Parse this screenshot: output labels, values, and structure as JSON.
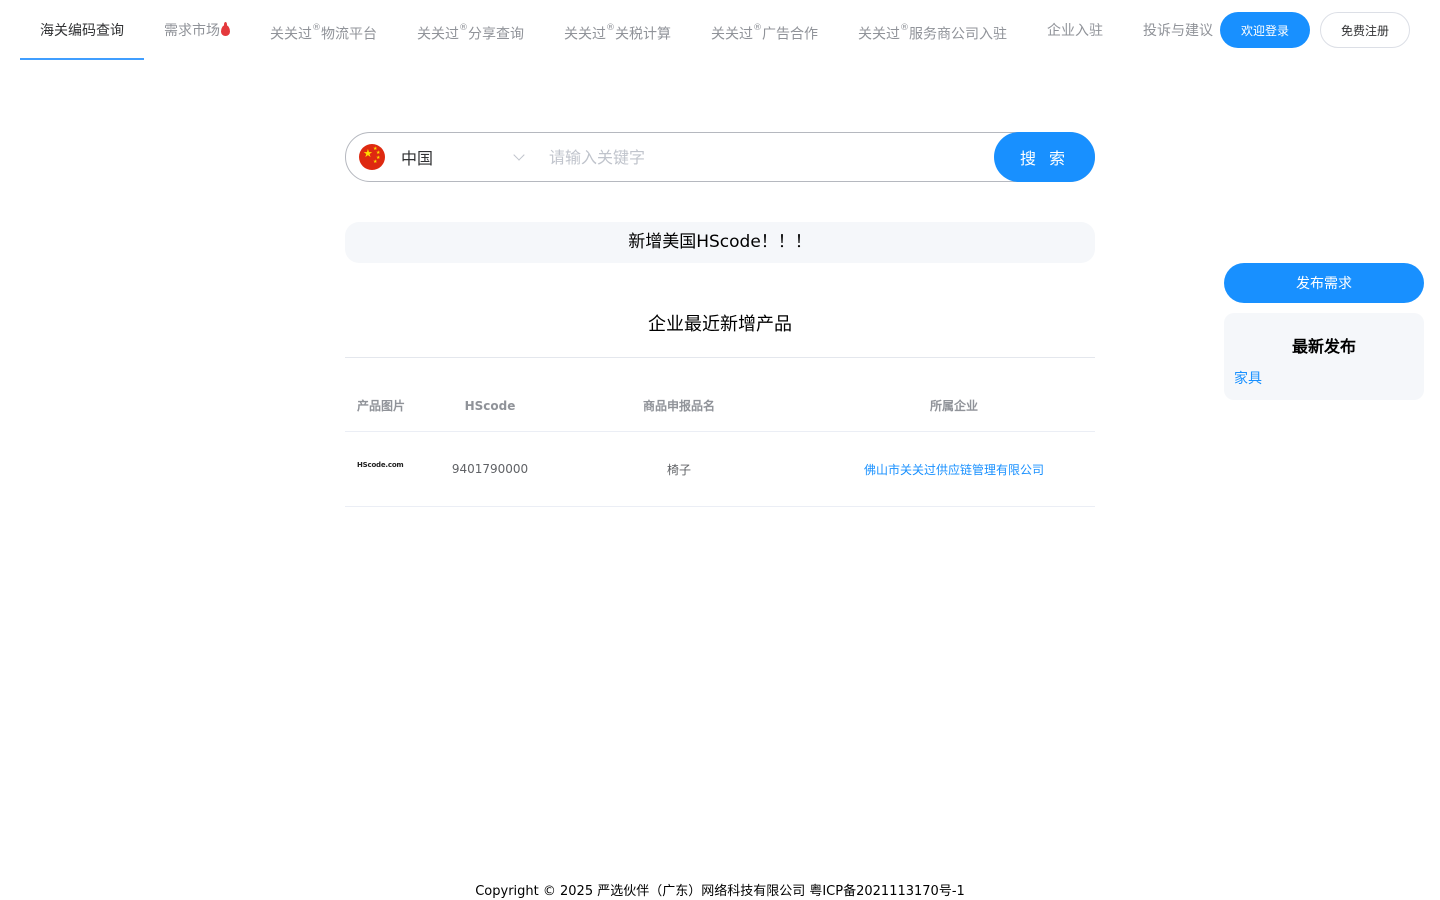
{
  "nav": {
    "items": [
      {
        "label": "海关编码查询"
      },
      {
        "label": "需求市场"
      },
      {
        "label": "关关过",
        "sup": "®",
        "suffix": "物流平台"
      },
      {
        "label": "关关过",
        "sup": "®",
        "suffix": "分享查询"
      },
      {
        "label": "关关过",
        "sup": "®",
        "suffix": "关税计算"
      },
      {
        "label": "关关过",
        "sup": "®",
        "suffix": "广告合作"
      },
      {
        "label": "关关过",
        "sup": "®",
        "suffix": "服务商公司入驻"
      },
      {
        "label": "企业入驻"
      },
      {
        "label": "投诉与建议"
      }
    ],
    "accent_color": "#409eff"
  },
  "auth": {
    "login_label": "欢迎登录",
    "register_label": "免费注册"
  },
  "search": {
    "country": "中国",
    "placeholder": "请输入关键字",
    "button_label": "搜 索"
  },
  "notice": "新增美国HScode！！！",
  "section_title": "企业最近新增产品",
  "table": {
    "headers": [
      "产品图片",
      "HScode",
      "商品申报品名",
      "所属企业"
    ],
    "rows": [
      {
        "image_text": "HScode.com",
        "hscode": "9401790000",
        "name": "椅子",
        "company": "佛山市关关过供应链管理有限公司"
      }
    ]
  },
  "sidebar": {
    "publish_label": "发布需求",
    "latest_title": "最新发布",
    "latest_items": [
      "家具"
    ]
  },
  "footer": "Copyright © 2025 严选伙伴（广东）网络科技有限公司 粤ICP备2021113170号-1",
  "colors": {
    "primary": "#1890ff",
    "panel_bg": "#f5f7fa"
  }
}
